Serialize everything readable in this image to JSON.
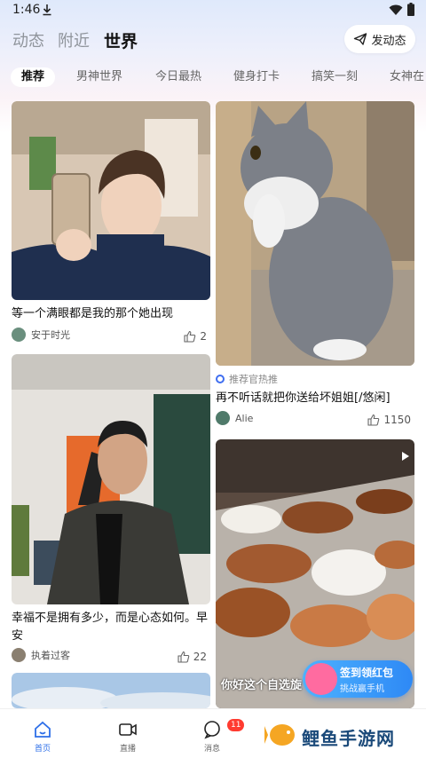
{
  "status": {
    "time": "1:46"
  },
  "top_tabs": [
    {
      "label": "动态",
      "active": false
    },
    {
      "label": "附近",
      "active": false
    },
    {
      "label": "世界",
      "active": true
    }
  ],
  "post_button": {
    "label": "发动态"
  },
  "categories": [
    {
      "label": "推荐",
      "active": true
    },
    {
      "label": "男神世界",
      "active": false
    },
    {
      "label": "今日最热",
      "active": false
    },
    {
      "label": "健身打卡",
      "active": false
    },
    {
      "label": "搞笑一刻",
      "active": false
    },
    {
      "label": "女神在",
      "active": false
    }
  ],
  "feed": {
    "card1": {
      "title": "等一个满眼都是我的那个她出现",
      "author": "安于时光",
      "likes": "2"
    },
    "card2": {
      "tag": "推荐官热推",
      "title": "再不听话就把你送给坏姐姐[/悠闲]",
      "author": "Alie",
      "likes": "1150"
    },
    "card3": {
      "title": "幸福不是拥有多少，而是心态如何。早安",
      "author": "执着过客",
      "likes": "22"
    },
    "card4": {
      "caption": "你好这个自选旋"
    }
  },
  "promo": {
    "title": "签到领红包",
    "subtitle": "挑战赢手机"
  },
  "tabbar": [
    {
      "label": "首页",
      "icon": "home-icon",
      "active": true
    },
    {
      "label": "直播",
      "icon": "video-icon",
      "active": false
    },
    {
      "label": "消息",
      "icon": "message-icon",
      "active": false
    }
  ],
  "message_badge": "11",
  "watermark": {
    "text": "鲤鱼手游网"
  },
  "colors": {
    "accent": "#2e6fe8",
    "badge": "#ff3b30",
    "promo": "#2e89f5"
  }
}
